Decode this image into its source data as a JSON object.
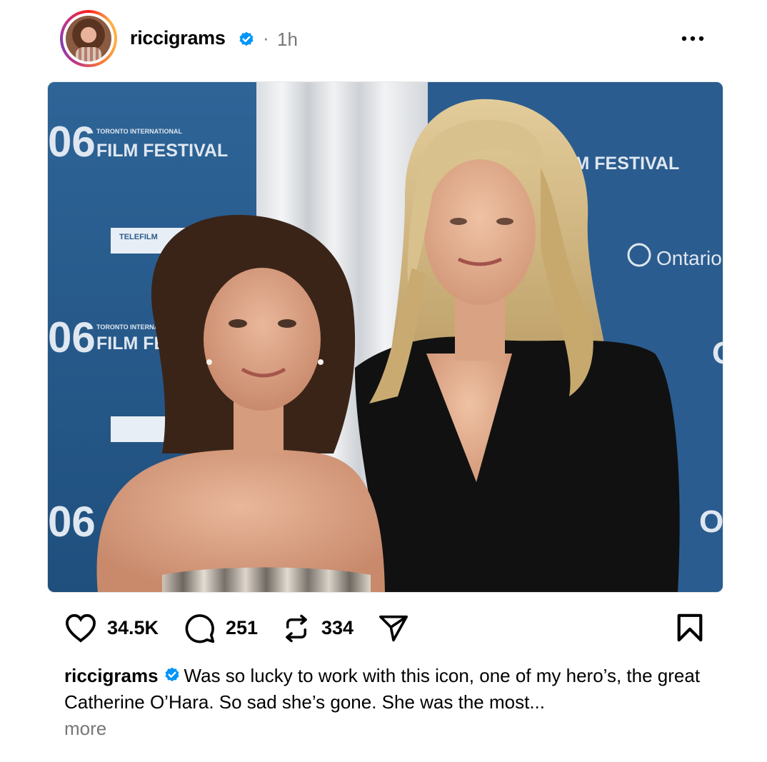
{
  "post": {
    "username": "riccigrams",
    "separator": "·",
    "time_ago": "1h",
    "verified": true
  },
  "photo": {
    "backdrop_text": {
      "festival_year": "06",
      "festival_small": "TORONTO INTERNATIONAL",
      "festival_big": "FILM FESTIVAL",
      "sponsor_telefilm": "TELEFILM",
      "sponsor_ontario": "Ontario"
    }
  },
  "actions": {
    "likes": "34.5K",
    "comments": "251",
    "reposts": "334"
  },
  "caption": {
    "username": "riccigrams",
    "text": "Was so lucky to work with this icon, one of my hero’s, the great Catherine O’Hara. So sad she’s gone. She was the most...",
    "more_label": "more"
  },
  "colors": {
    "verified_blue": "#0095f6",
    "muted_text": "#777777",
    "backdrop_blue": "#2a5b8c"
  }
}
